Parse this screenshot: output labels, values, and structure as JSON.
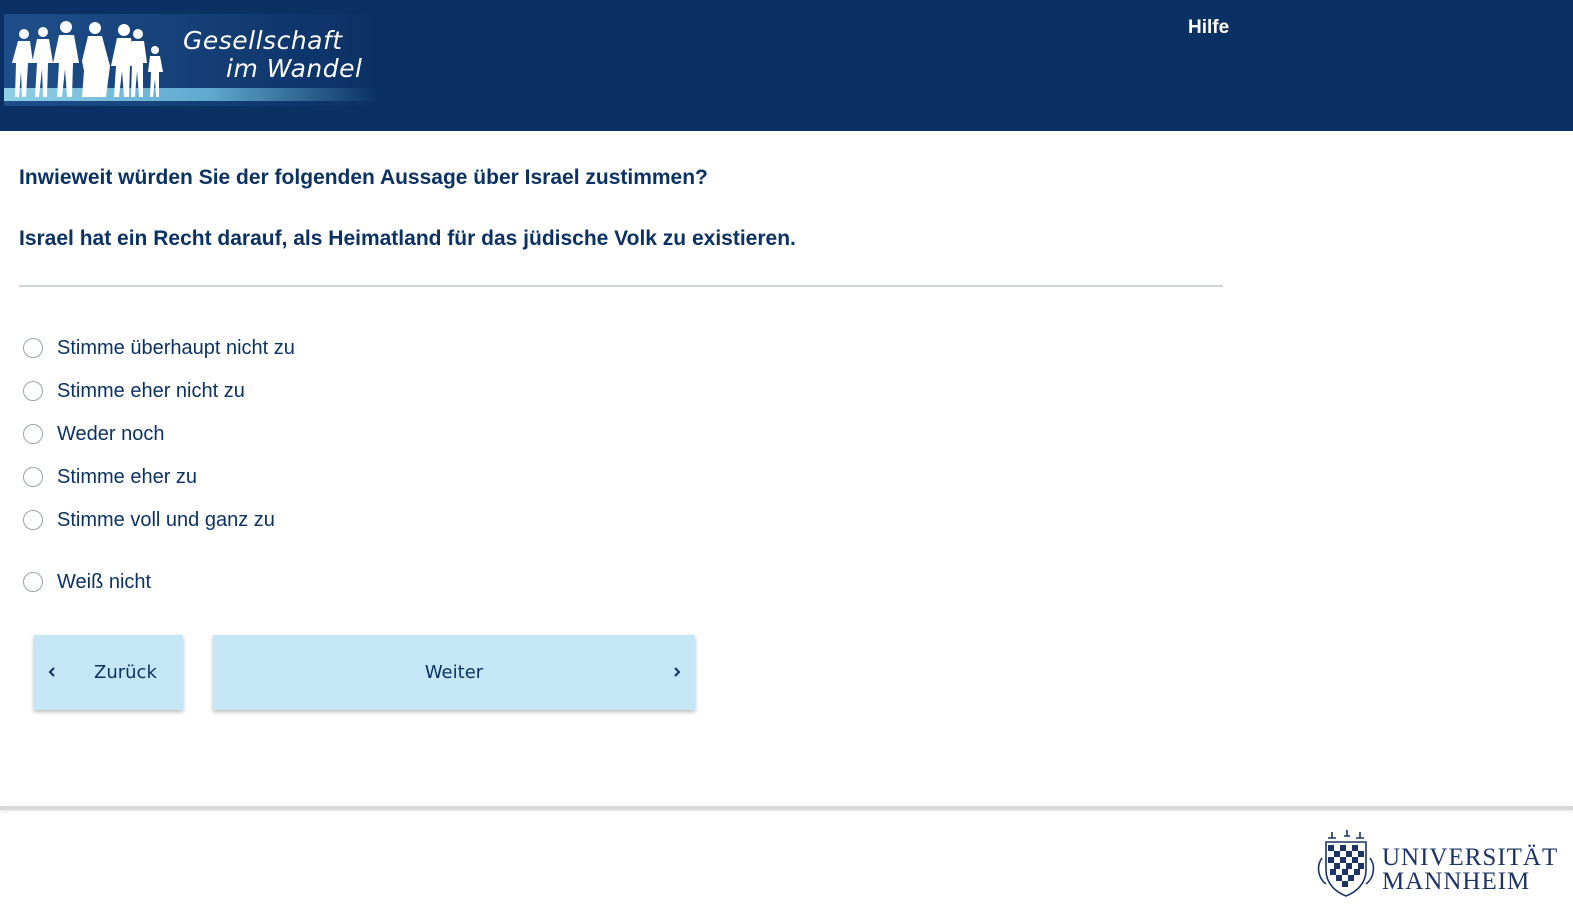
{
  "header": {
    "logo": {
      "line1": "Gesellschaft",
      "line2": "im Wandel"
    },
    "help_label": "Hilfe"
  },
  "question": {
    "prompt": "Inwieweit würden Sie der folgenden Aussage über Israel zustimmen?",
    "statement": "Israel hat ein Recht darauf, als Heimatland für das jüdische Volk zu existieren."
  },
  "options": [
    {
      "label": "Stimme überhaupt nicht zu",
      "selected": false
    },
    {
      "label": "Stimme eher nicht zu",
      "selected": false
    },
    {
      "label": "Weder noch",
      "selected": false
    },
    {
      "label": "Stimme eher zu",
      "selected": false
    },
    {
      "label": "Stimme voll und ganz zu",
      "selected": false
    },
    {
      "label": "Weiß nicht",
      "selected": false
    }
  ],
  "navigation": {
    "back_label": "Zurück",
    "next_label": "Weiter"
  },
  "footer": {
    "university_line1": "UNIVERSITÄT",
    "university_line2": "MANNHEIM"
  },
  "colors": {
    "header_bg": "#0b3064",
    "text_primary": "#0c3263",
    "button_bg": "#c5e6f4"
  }
}
